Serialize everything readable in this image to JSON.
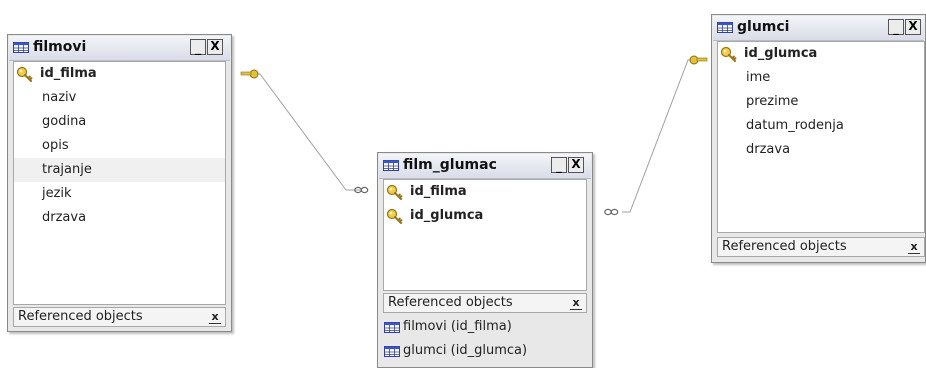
{
  "tables": [
    {
      "name": "filmovi",
      "columns": [
        {
          "label": "id_filma",
          "pk": true
        },
        {
          "label": "naziv",
          "pk": false
        },
        {
          "label": "godina",
          "pk": false
        },
        {
          "label": "opis",
          "pk": false
        },
        {
          "label": "trajanje",
          "pk": false,
          "highlighted": true
        },
        {
          "label": "jezik",
          "pk": false
        },
        {
          "label": "drzava",
          "pk": false
        }
      ],
      "referenced_label": "Referenced objects",
      "referenced_items": []
    },
    {
      "name": "film_glumac",
      "columns": [
        {
          "label": "id_filma",
          "pk": true
        },
        {
          "label": "id_glumca",
          "pk": true
        }
      ],
      "referenced_label": "Referenced objects",
      "referenced_items": [
        "filmovi (id_filma)",
        "glumci (id_glumca)"
      ]
    },
    {
      "name": "glumci",
      "columns": [
        {
          "label": "id_glumca",
          "pk": true
        },
        {
          "label": "ime",
          "pk": false
        },
        {
          "label": "prezime",
          "pk": false
        },
        {
          "label": "datum_rodenja",
          "pk": false
        },
        {
          "label": "drzava",
          "pk": false
        }
      ],
      "referenced_label": "Referenced objects",
      "referenced_items": []
    }
  ],
  "window_buttons": {
    "minimize": "_",
    "close": "X"
  },
  "ref_close_glyph": "x",
  "colors": {
    "key_gold": "#d9b43a",
    "relation_line": "#9a9a9a",
    "title_bar": "#dde1ea"
  }
}
